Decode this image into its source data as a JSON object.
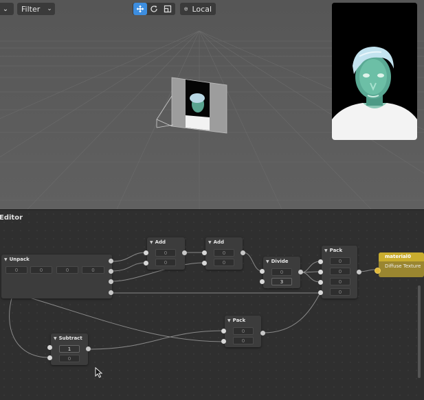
{
  "toolbar": {
    "left_dropdown_chevron": "⌄",
    "filter_label": "Filter",
    "space_label": "Local"
  },
  "editor": {
    "title": "Editor"
  },
  "nodes": {
    "unpack": {
      "title": "Unpack",
      "fields": [
        "0",
        "0",
        "0",
        "0"
      ]
    },
    "add1": {
      "title": "Add",
      "fields": [
        "0",
        "0"
      ]
    },
    "add2": {
      "title": "Add",
      "fields": [
        "0",
        "0"
      ]
    },
    "divide": {
      "title": "Divide",
      "fields": [
        "0",
        "3"
      ]
    },
    "pack1": {
      "title": "Pack",
      "fields": [
        "0",
        "0",
        "0",
        "0"
      ]
    },
    "pack2": {
      "title": "Pack",
      "fields": [
        "0",
        "0"
      ]
    },
    "subtract": {
      "title": "Subtract",
      "fields": [
        "1",
        "0"
      ]
    },
    "material": {
      "title": "material0",
      "input_label": "Diffuse Texture"
    }
  },
  "colors": {
    "accent": "#3d8ee0",
    "material": "#c9ad2e"
  }
}
